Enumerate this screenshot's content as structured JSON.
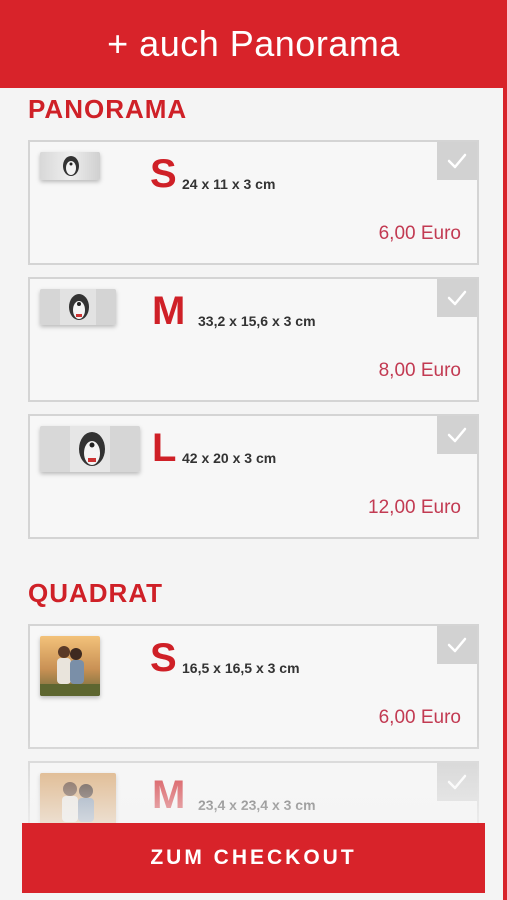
{
  "header": {
    "title": "+ auch Panorama"
  },
  "sections": [
    {
      "title": "PANORAMA",
      "items": [
        {
          "size": "S",
          "dimensions": "24 x 11 x 3 cm",
          "price": "6,00 Euro",
          "thumb": "dog-panorama-photo"
        },
        {
          "size": "M",
          "dimensions": "33,2 x 15,6 x 3 cm",
          "price": "8,00 Euro",
          "thumb": "dog-panorama-photo"
        },
        {
          "size": "L",
          "dimensions": "42 x 20 x 3 cm",
          "price": "12,00 Euro",
          "thumb": "dog-panorama-photo"
        }
      ]
    },
    {
      "title": "QUADRAT",
      "items": [
        {
          "size": "S",
          "dimensions": "16,5 x 16,5 x 3 cm",
          "price": "6,00 Euro",
          "thumb": "couple-square-photo"
        },
        {
          "size": "M",
          "dimensions": "23,4 x 23,4 x 3 cm",
          "price": "",
          "thumb": "couple-square-photo"
        }
      ]
    }
  ],
  "checkout": {
    "label": "ZUM CHECKOUT"
  },
  "colors": {
    "brand_red": "#d8232a",
    "price_red": "#c23a52",
    "check_gray": "#d2d2d2"
  }
}
